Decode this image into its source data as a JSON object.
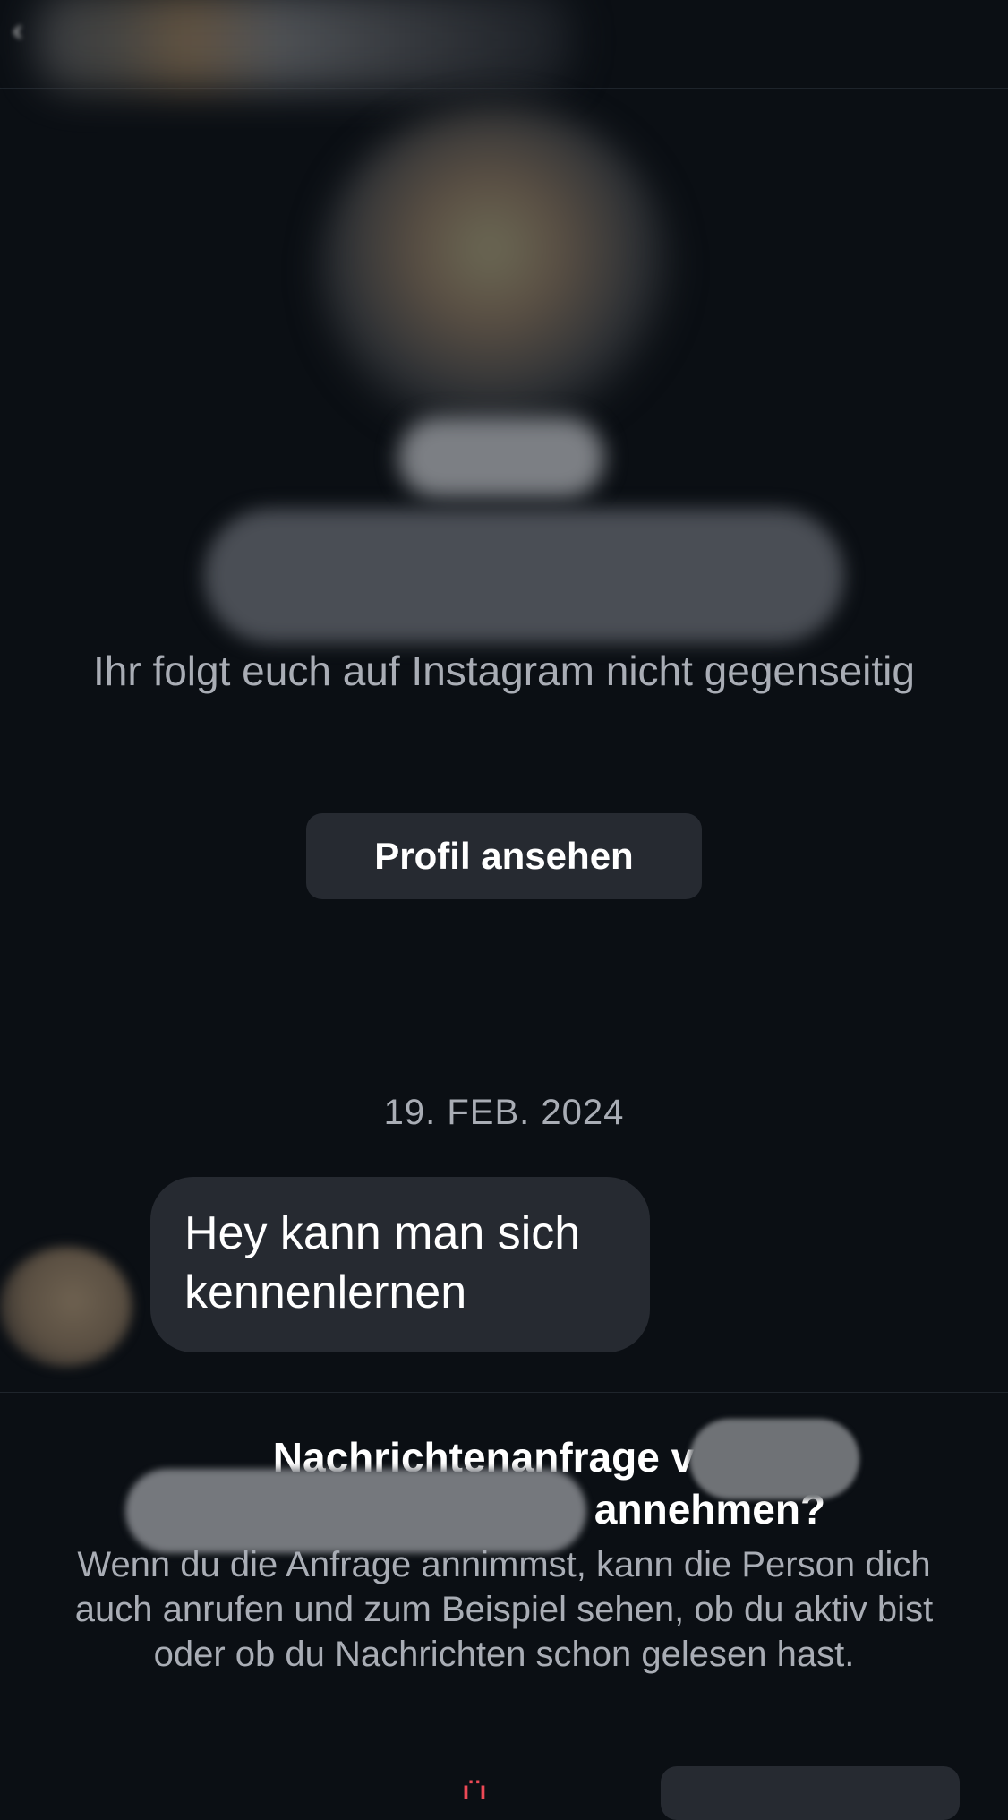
{
  "header": {
    "back_icon": "chevron-left-icon"
  },
  "profile": {
    "follow_status": "Ihr folgt euch auf Instagram nicht gegenseitig",
    "view_profile_label": "Profil ansehen"
  },
  "conversation": {
    "date": "19. FEB. 2024",
    "messages": [
      {
        "text": "Hey kann man sich kennenlernen",
        "from": "sender"
      }
    ]
  },
  "request": {
    "title_part1": "Nachrichtenanfrage vor",
    "title_part2": "annehmen?",
    "description": "Wenn du die Anfrage annimmst, kann die Person dich auch anrufen und zum Beispiel sehen, ob du aktiv bist oder ob du Nachrichten schon gelesen hast."
  },
  "colors": {
    "background": "#0b0f14",
    "bubble": "#262a31",
    "secondary_text": "#a9adb5",
    "danger": "#ed4956"
  }
}
